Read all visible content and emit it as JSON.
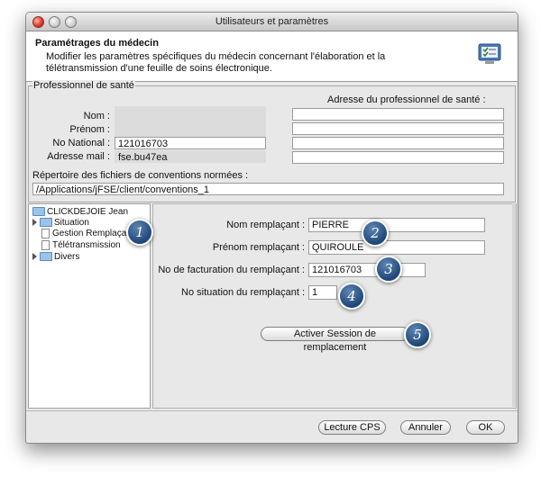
{
  "window": {
    "title": "Utilisateurs et paramètres"
  },
  "header": {
    "title": "Paramétrages du médecin",
    "description": "Modifier les paramètres spécifiques du médecin concernant l'élaboration et la télétransmission d'une feuille de soins électronique.",
    "icon": "settings-checklist-icon"
  },
  "professionnel": {
    "legend": "Professionnel de santé",
    "nom_label": "Nom :",
    "nom_value": "",
    "prenom_label": "Prénom :",
    "prenom_value": "",
    "no_national_label": "No National :",
    "no_national_value": "121016703",
    "adresse_mail_label": "Adresse mail :",
    "adresse_mail_value": "fse.bu47ea",
    "adresse_title": "Adresse du professionnel de santé :",
    "adresse_lines": [
      "",
      "",
      "",
      ""
    ],
    "repertoire_label": "Répertoire des fichiers de conventions normées :",
    "repertoire_value": "/Applications/jFSE/client/conventions_1"
  },
  "tree": {
    "root": "CLICKDEJOIE Jean",
    "items": [
      {
        "label": "Situation",
        "type": "folder",
        "expandable": true
      },
      {
        "label": "Gestion Remplaçant",
        "type": "doc",
        "selected": true
      },
      {
        "label": "Télétransmission",
        "type": "doc"
      },
      {
        "label": "Divers",
        "type": "folder",
        "expandable": true
      }
    ]
  },
  "remplacant": {
    "nom_label": "Nom remplaçant :",
    "nom_value": "PIERRE",
    "prenom_label": "Prénom remplaçant :",
    "prenom_value": "QUIROULE",
    "facturation_label": "No de facturation du remplaçant :",
    "facturation_value": "121016703",
    "situation_label": "No situation du remplaçant :",
    "situation_value": "1",
    "activer_button": "Activer Session de remplacement"
  },
  "footer": {
    "lecture_cps": "Lecture CPS",
    "annuler": "Annuler",
    "ok": "OK"
  },
  "callouts": [
    "1",
    "2",
    "3",
    "4",
    "5"
  ],
  "colors": {
    "selection": "#3875d7",
    "callout": "#1e4778"
  }
}
